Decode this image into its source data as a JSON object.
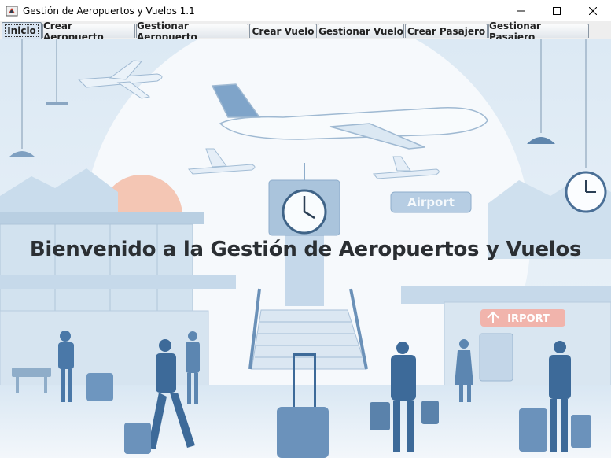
{
  "window": {
    "title": "Gestión de Aeropuertos y Vuelos 1.1",
    "controls": [
      "minimize-icon",
      "maximize-icon",
      "close-icon"
    ]
  },
  "tabs": [
    {
      "label": "Inicio",
      "selected": true
    },
    {
      "label": "Crear Aeropuerto",
      "selected": false
    },
    {
      "label": "Gestionar Aeropuerto",
      "selected": false
    },
    {
      "label": "Crear Vuelo",
      "selected": false
    },
    {
      "label": "Gestionar Vuelo",
      "selected": false
    },
    {
      "label": "Crear Pasajero",
      "selected": false
    },
    {
      "label": "Gestionar Pasajero",
      "selected": false
    }
  ],
  "main": {
    "welcome_text": "Bienvenido a la Gestión de Aeropuertos y Vuelos",
    "sign_airport": "Airport",
    "sign_airport2": "IRPORT"
  },
  "colors": {
    "accent_blue": "#4a78a8",
    "sky": "#e6f0f8",
    "sun": "#f4c6b4"
  }
}
